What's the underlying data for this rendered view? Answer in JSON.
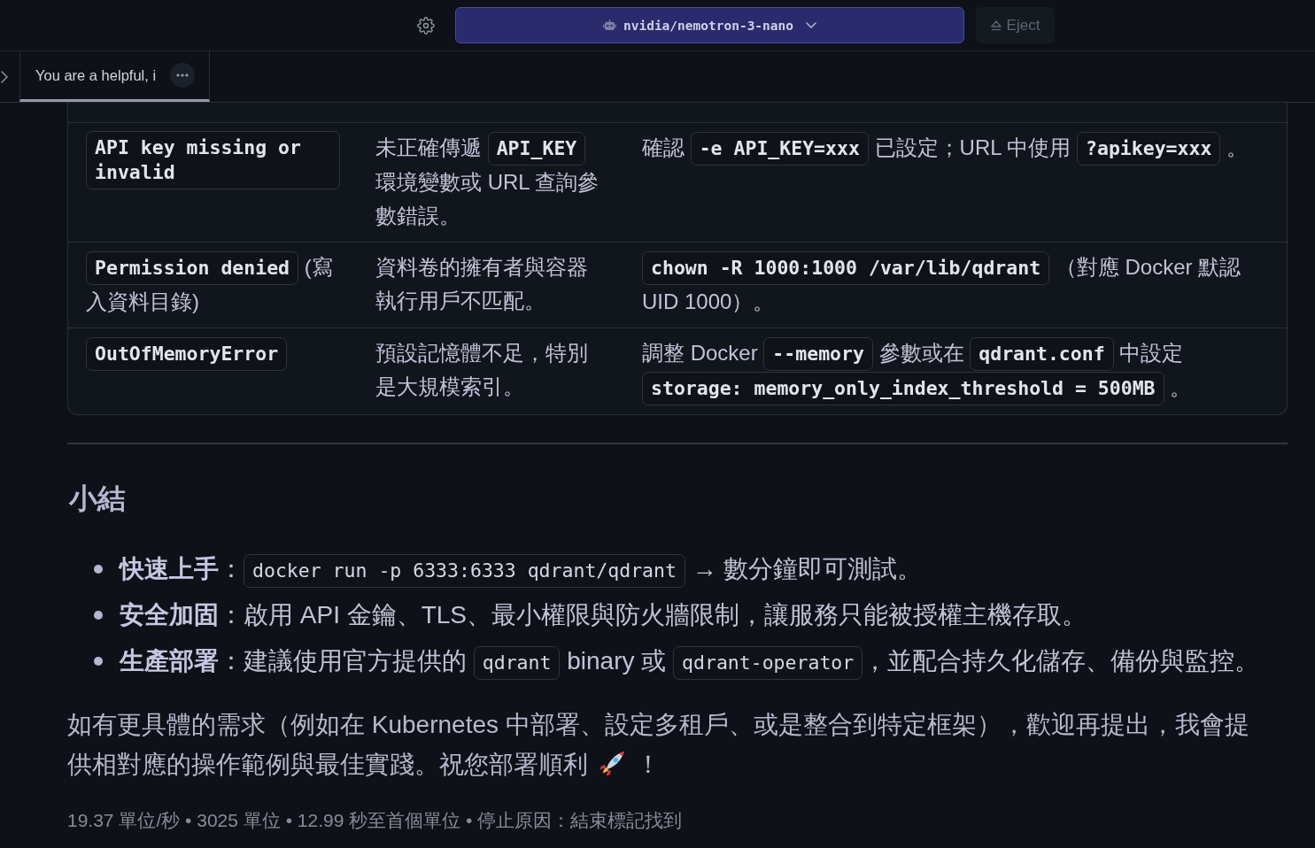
{
  "top_bar": {
    "model_selector": {
      "label": "nvidia/nemotron-3-nano"
    },
    "eject_button": {
      "label": "Eject",
      "disabled": true
    }
  },
  "tabs": [
    {
      "label": "You are a helpful, i",
      "selected": true
    }
  ],
  "table": {
    "rows": [
      {
        "cells": [
          [
            {
              "kind": "code",
              "text": "API key missing or invalid"
            }
          ],
          [
            {
              "kind": "text",
              "text": "未正確傳遞 "
            },
            {
              "kind": "code",
              "text": "API_KEY"
            },
            {
              "kind": "text",
              "text": " 環境變數或 URL 查詢參數錯誤。"
            }
          ],
          [
            {
              "kind": "text",
              "text": "確認 "
            },
            {
              "kind": "code",
              "text": "-e API_KEY=xxx"
            },
            {
              "kind": "text",
              "text": " 已設定；URL 中使用 "
            },
            {
              "kind": "code",
              "text": "?apikey=xxx"
            },
            {
              "kind": "text",
              "text": " 。"
            }
          ]
        ]
      },
      {
        "cells": [
          [
            {
              "kind": "code",
              "text": "Permission denied"
            },
            {
              "kind": "text",
              "text": " (寫入資料目錄)"
            }
          ],
          [
            {
              "kind": "text",
              "text": "資料卷的擁有者與容器執行用戶不匹配。"
            }
          ],
          [
            {
              "kind": "code",
              "text": "chown -R 1000:1000 /var/lib/qdrant"
            },
            {
              "kind": "text",
              "text": " （對應 Docker 默認 UID 1000）。"
            }
          ]
        ]
      },
      {
        "cells": [
          [
            {
              "kind": "code",
              "text": "OutOfMemoryError"
            }
          ],
          [
            {
              "kind": "text",
              "text": "預設記憶體不足，特別是大規模索引。"
            }
          ],
          [
            {
              "kind": "text",
              "text": "調整 Docker "
            },
            {
              "kind": "code",
              "text": "--memory"
            },
            {
              "kind": "text",
              "text": " 參數或在 "
            },
            {
              "kind": "code",
              "text": "qdrant.conf"
            },
            {
              "kind": "text",
              "text": " 中設定 "
            },
            {
              "kind": "code",
              "text": "storage: memory_only_index_threshold = 500MB"
            },
            {
              "kind": "text",
              "text": " 。"
            }
          ]
        ]
      }
    ]
  },
  "summary": {
    "heading": "小結",
    "bullets": [
      {
        "label": "快速上手",
        "segments": [
          {
            "kind": "text",
            "text": "："
          },
          {
            "kind": "code",
            "text": "docker run -p 6333:6333 qdrant/qdrant"
          },
          {
            "kind": "text",
            "text": " → 數分鐘即可測試。"
          }
        ]
      },
      {
        "label": "安全加固",
        "segments": [
          {
            "kind": "text",
            "text": "：啟用 API 金鑰、TLS、最小權限與防火牆限制，讓服務只能被授權主機存取。"
          }
        ]
      },
      {
        "label": "生產部署",
        "segments": [
          {
            "kind": "text",
            "text": "：建議使用官方提供的 "
          },
          {
            "kind": "code",
            "text": "qdrant"
          },
          {
            "kind": "text",
            "text": " binary 或 "
          },
          {
            "kind": "code",
            "text": "qdrant-operator"
          },
          {
            "kind": "text",
            "text": "，並配合持久化儲存、備份與監控。"
          }
        ]
      }
    ]
  },
  "closing": {
    "text": "如有更具體的需求（例如在 Kubernetes 中部署、設定多租戶、或是整合到特定框架），歡迎再提出，我會提供相對應的操作範例與最佳實踐。祝您部署順利",
    "text_after_icon": "！"
  },
  "stats": "19.37 單位/秒 • 3025 單位 • 12.99 秒至首個單位 • 停止原因：結束標記找到"
}
